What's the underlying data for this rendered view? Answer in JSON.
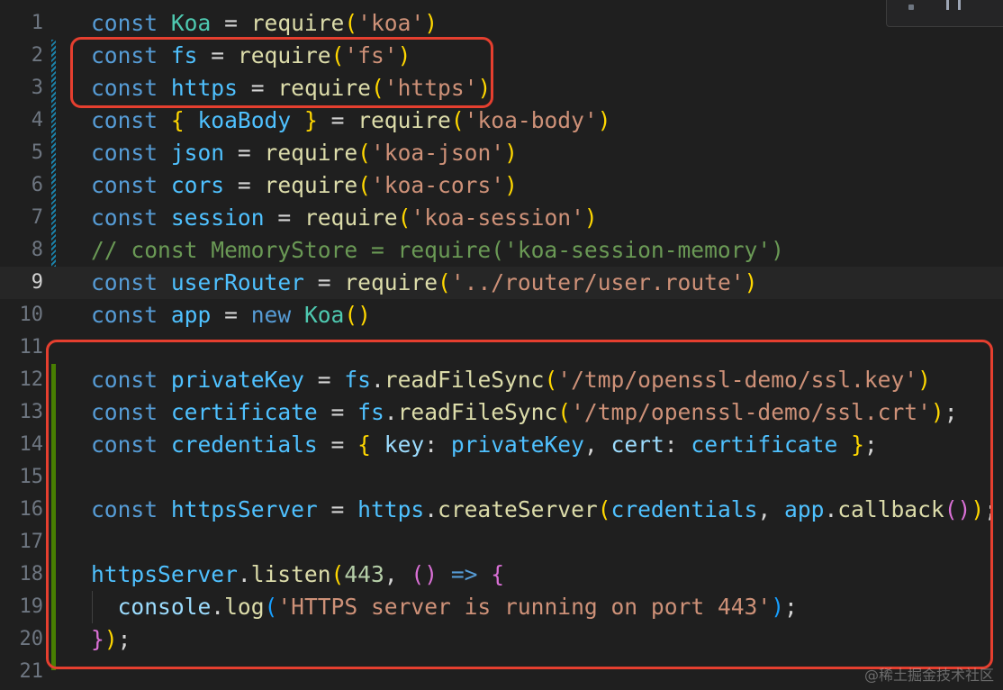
{
  "editor": {
    "language": "javascript",
    "active_line": 9,
    "lines": [
      {
        "n": "1",
        "tokens": [
          [
            "kw",
            "const"
          ],
          [
            "op",
            " "
          ],
          [
            "cls",
            "Koa"
          ],
          [
            "op",
            " = "
          ],
          [
            "fn",
            "require"
          ],
          [
            "b1",
            "("
          ],
          [
            "str",
            "'koa'"
          ],
          [
            "b1",
            ")"
          ]
        ]
      },
      {
        "n": "2",
        "tokens": [
          [
            "kw",
            "const"
          ],
          [
            "op",
            " "
          ],
          [
            "var",
            "fs"
          ],
          [
            "op",
            " = "
          ],
          [
            "fn",
            "require"
          ],
          [
            "b1",
            "("
          ],
          [
            "str",
            "'fs'"
          ],
          [
            "b1",
            ")"
          ]
        ]
      },
      {
        "n": "3",
        "tokens": [
          [
            "kw",
            "const"
          ],
          [
            "op",
            " "
          ],
          [
            "var",
            "https"
          ],
          [
            "op",
            " = "
          ],
          [
            "fn",
            "require"
          ],
          [
            "b1",
            "("
          ],
          [
            "str",
            "'https'"
          ],
          [
            "b1",
            ")"
          ]
        ]
      },
      {
        "n": "4",
        "tokens": [
          [
            "kw",
            "const"
          ],
          [
            "op",
            " "
          ],
          [
            "b1",
            "{"
          ],
          [
            "op",
            " "
          ],
          [
            "var",
            "koaBody"
          ],
          [
            "op",
            " "
          ],
          [
            "b1",
            "}"
          ],
          [
            "op",
            " = "
          ],
          [
            "fn",
            "require"
          ],
          [
            "b1",
            "("
          ],
          [
            "str",
            "'koa-body'"
          ],
          [
            "b1",
            ")"
          ]
        ]
      },
      {
        "n": "5",
        "tokens": [
          [
            "kw",
            "const"
          ],
          [
            "op",
            " "
          ],
          [
            "var",
            "json"
          ],
          [
            "op",
            " = "
          ],
          [
            "fn",
            "require"
          ],
          [
            "b1",
            "("
          ],
          [
            "str",
            "'koa-json'"
          ],
          [
            "b1",
            ")"
          ]
        ]
      },
      {
        "n": "6",
        "tokens": [
          [
            "kw",
            "const"
          ],
          [
            "op",
            " "
          ],
          [
            "var",
            "cors"
          ],
          [
            "op",
            " = "
          ],
          [
            "fn",
            "require"
          ],
          [
            "b1",
            "("
          ],
          [
            "str",
            "'koa-cors'"
          ],
          [
            "b1",
            ")"
          ]
        ]
      },
      {
        "n": "7",
        "tokens": [
          [
            "kw",
            "const"
          ],
          [
            "op",
            " "
          ],
          [
            "var",
            "session"
          ],
          [
            "op",
            " = "
          ],
          [
            "fn",
            "require"
          ],
          [
            "b1",
            "("
          ],
          [
            "str",
            "'koa-session'"
          ],
          [
            "b1",
            ")"
          ]
        ]
      },
      {
        "n": "8",
        "tokens": [
          [
            "cmt",
            "// const MemoryStore = require('koa-session-memory')"
          ]
        ]
      },
      {
        "n": "9",
        "tokens": [
          [
            "kw",
            "const"
          ],
          [
            "op",
            " "
          ],
          [
            "var",
            "userRouter"
          ],
          [
            "op",
            " = "
          ],
          [
            "fn",
            "require"
          ],
          [
            "b1",
            "("
          ],
          [
            "str",
            "'../router/user.route'"
          ],
          [
            "b1",
            ")"
          ]
        ]
      },
      {
        "n": "10",
        "tokens": [
          [
            "kw",
            "const"
          ],
          [
            "op",
            " "
          ],
          [
            "var",
            "app"
          ],
          [
            "op",
            " = "
          ],
          [
            "kw",
            "new"
          ],
          [
            "op",
            " "
          ],
          [
            "cls",
            "Koa"
          ],
          [
            "b1",
            "()"
          ]
        ]
      },
      {
        "n": "11",
        "tokens": []
      },
      {
        "n": "12",
        "tokens": [
          [
            "kw",
            "const"
          ],
          [
            "op",
            " "
          ],
          [
            "var",
            "privateKey"
          ],
          [
            "op",
            " = "
          ],
          [
            "var",
            "fs"
          ],
          [
            "op",
            "."
          ],
          [
            "fn",
            "readFileSync"
          ],
          [
            "b1",
            "("
          ],
          [
            "str",
            "'/tmp/openssl-demo/ssl.key'"
          ],
          [
            "b1",
            ")"
          ]
        ]
      },
      {
        "n": "13",
        "tokens": [
          [
            "kw",
            "const"
          ],
          [
            "op",
            " "
          ],
          [
            "var",
            "certificate"
          ],
          [
            "op",
            " = "
          ],
          [
            "var",
            "fs"
          ],
          [
            "op",
            "."
          ],
          [
            "fn",
            "readFileSync"
          ],
          [
            "b1",
            "("
          ],
          [
            "str",
            "'/tmp/openssl-demo/ssl.crt'"
          ],
          [
            "b1",
            ")"
          ],
          [
            "op",
            ";"
          ]
        ]
      },
      {
        "n": "14",
        "tokens": [
          [
            "kw",
            "const"
          ],
          [
            "op",
            " "
          ],
          [
            "var",
            "credentials"
          ],
          [
            "op",
            " = "
          ],
          [
            "b1",
            "{"
          ],
          [
            "op",
            " "
          ],
          [
            "prop",
            "key"
          ],
          [
            "op",
            ": "
          ],
          [
            "var",
            "privateKey"
          ],
          [
            "op",
            ", "
          ],
          [
            "prop",
            "cert"
          ],
          [
            "op",
            ": "
          ],
          [
            "var",
            "certificate"
          ],
          [
            "op",
            " "
          ],
          [
            "b1",
            "}"
          ],
          [
            "op",
            ";"
          ]
        ]
      },
      {
        "n": "15",
        "tokens": []
      },
      {
        "n": "16",
        "tokens": [
          [
            "kw",
            "const"
          ],
          [
            "op",
            " "
          ],
          [
            "var",
            "httpsServer"
          ],
          [
            "op",
            " = "
          ],
          [
            "var",
            "https"
          ],
          [
            "op",
            "."
          ],
          [
            "fn",
            "createServer"
          ],
          [
            "b1",
            "("
          ],
          [
            "var",
            "credentials"
          ],
          [
            "op",
            ", "
          ],
          [
            "var",
            "app"
          ],
          [
            "op",
            "."
          ],
          [
            "fn",
            "callback"
          ],
          [
            "b2",
            "()"
          ],
          [
            "b1",
            ")"
          ],
          [
            "op",
            ";"
          ]
        ]
      },
      {
        "n": "17",
        "tokens": []
      },
      {
        "n": "18",
        "tokens": [
          [
            "var",
            "httpsServer"
          ],
          [
            "op",
            "."
          ],
          [
            "fn",
            "listen"
          ],
          [
            "b1",
            "("
          ],
          [
            "num",
            "443"
          ],
          [
            "op",
            ", "
          ],
          [
            "b2",
            "()"
          ],
          [
            "op",
            " "
          ],
          [
            "kw",
            "=>"
          ],
          [
            "op",
            " "
          ],
          [
            "b2",
            "{"
          ]
        ]
      },
      {
        "n": "19",
        "tokens": [
          [
            "op",
            "  "
          ],
          [
            "prop",
            "console"
          ],
          [
            "op",
            "."
          ],
          [
            "fn",
            "log"
          ],
          [
            "b3",
            "("
          ],
          [
            "str",
            "'HTTPS server is running on port 443'"
          ],
          [
            "b3",
            ")"
          ],
          [
            "op",
            ";"
          ]
        ]
      },
      {
        "n": "20",
        "tokens": [
          [
            "b2",
            "}"
          ],
          [
            "b1",
            ")"
          ],
          [
            "op",
            ";"
          ]
        ]
      },
      {
        "n": "21",
        "tokens": []
      }
    ]
  },
  "watermark": "@稀土掘金技术社区"
}
